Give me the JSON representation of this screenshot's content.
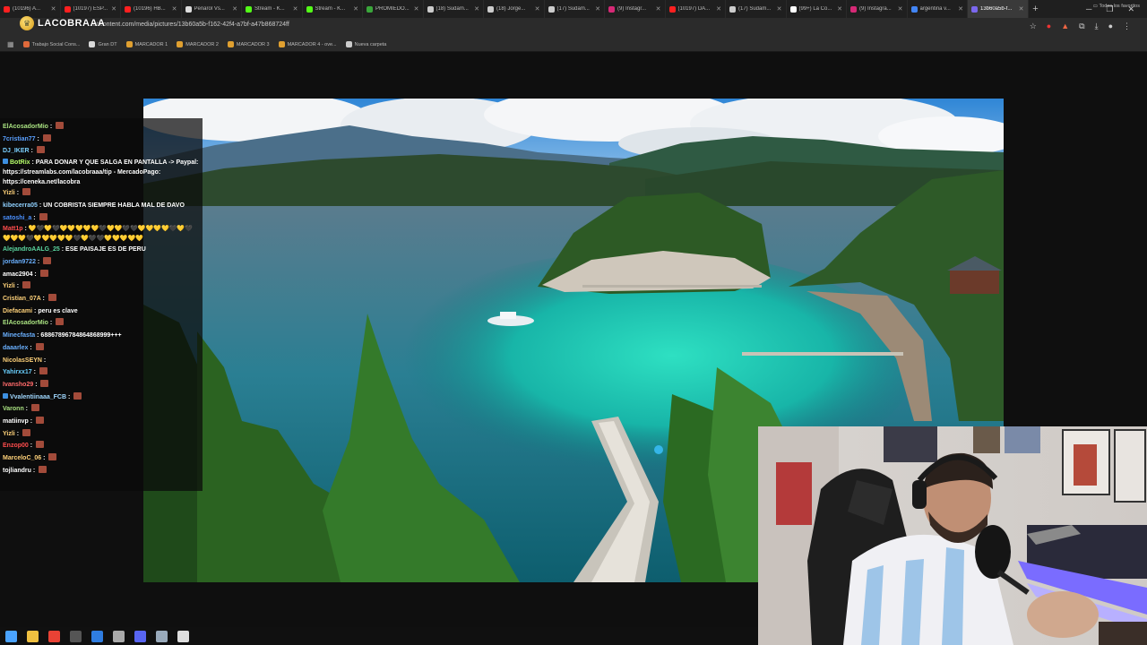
{
  "browser": {
    "tabs": [
      {
        "label": "(10196) A...",
        "color": "#ff2020",
        "active": false
      },
      {
        "label": "(10197) ESP...",
        "color": "#ff2020",
        "active": false
      },
      {
        "label": "(10196) HB...",
        "color": "#ff2020",
        "active": false
      },
      {
        "label": "Peñarol Vs...",
        "color": "#dddddd",
        "active": false
      },
      {
        "label": "Stream - K...",
        "color": "#53fc18",
        "active": false
      },
      {
        "label": "Stream - K...",
        "color": "#53fc18",
        "active": false
      },
      {
        "label": "PROMIEDO...",
        "color": "#3aa63a",
        "active": false
      },
      {
        "label": "(18) Sudam...",
        "color": "#cccccc",
        "active": false
      },
      {
        "label": "(18) Jorge...",
        "color": "#cccccc",
        "active": false
      },
      {
        "label": "(17) Sudam...",
        "color": "#cccccc",
        "active": false
      },
      {
        "label": "(9) Instagr...",
        "color": "#d62976",
        "active": false
      },
      {
        "label": "(10197) DA...",
        "color": "#ff2020",
        "active": false
      },
      {
        "label": "(17) Sudam...",
        "color": "#cccccc",
        "active": false
      },
      {
        "label": "(99+) La Co...",
        "color": "#ffffff",
        "active": false
      },
      {
        "label": "(9) Instagra...",
        "color": "#d62976",
        "active": false
      },
      {
        "label": "argentina v...",
        "color": "#4285f4",
        "active": false
      },
      {
        "label": "13b60a5b-f...",
        "color": "#7b68ee",
        "active": true
      }
    ],
    "new_tab": "+",
    "url": "...aticontent.com/media/pictures/13b60a5b-f162-42f4-a7bf-a47b868724ff",
    "bookmarks": [
      {
        "label": "Trabajo Social Cons...",
        "color": "#e06a3b"
      },
      {
        "label": "Gran DT",
        "color": "#d9d9d9"
      },
      {
        "label": "MARCADOR 1",
        "color": "#e0a030"
      },
      {
        "label": "MARCADOR 2",
        "color": "#e0a030"
      },
      {
        "label": "MARCADOR 3",
        "color": "#e0a030"
      },
      {
        "label": "MARCADOR 4 - ove...",
        "color": "#e0a030"
      },
      {
        "label": "Nueva carpeta",
        "color": "#cccccc"
      }
    ],
    "all_bookmarks": "Todos los favoritos"
  },
  "stream": {
    "logo_text": "LACOBRAAA"
  },
  "chat": [
    {
      "user": "ElAcosadorMio",
      "color": "#a8e080",
      "text": "",
      "emote": true
    },
    {
      "user": "7cristian77",
      "color": "#5aa0ff",
      "text": "",
      "emote": true
    },
    {
      "user": "DJ_IKER",
      "color": "#7ad0ff",
      "text": "",
      "emote": true
    },
    {
      "user": "BotRix",
      "color": "#b6ff6a",
      "text": "PARA DONAR Y QUE SALGA EN PANTALLA -> Paypal: https://streamlabs.com/lacobraaa/tip - MercadoPago: https://ceneka.net/lacobra",
      "emote": false,
      "badge": true,
      "multi": true
    },
    {
      "user": "Yizli",
      "color": "#ffd27a",
      "text": "",
      "emote": true
    },
    {
      "user": "kibecerra05",
      "color": "#8fd0ff",
      "text": "UN COBRISTA SIEMPRE HABLA MAL DE DAVO",
      "emote": false
    },
    {
      "user": "satoshi_a",
      "color": "#4a90ff",
      "text": "",
      "emote": true
    },
    {
      "user": "Matt1p",
      "color": "#ff4d4d",
      "text": "💛🖤💛🖤💛💛💛💛💛🖤💛💛🖤🖤💛💛💛💛🖤💛🖤💛💛💛🖤💛💛💛💛💛🖤💛🖤🖤💛💛💛💛💛",
      "emote": false,
      "multi": true
    },
    {
      "user": "AlejandroAALG_25",
      "color": "#5bd6a0",
      "text": "ESE PAISAJE ES DE PERU",
      "emote": false
    },
    {
      "user": "jordan9722",
      "color": "#6ab0ff",
      "text": "",
      "emote": true
    },
    {
      "user": "amac2904",
      "color": "#ffffff",
      "text": "",
      "emote": true
    },
    {
      "user": "Yizli",
      "color": "#ffd27a",
      "text": "",
      "emote": true
    },
    {
      "user": "Cristian_07A",
      "color": "#ffd27a",
      "text": "",
      "emote": true
    },
    {
      "user": "Diefacami",
      "color": "#ffd27a",
      "text": "peru es clave",
      "emote": false
    },
    {
      "user": "ElAcosadorMio",
      "color": "#a8e080",
      "text": "",
      "emote": true
    },
    {
      "user": "Minecfasta",
      "color": "#6ab0ff",
      "text": "68867896784864868999+++",
      "emote": false
    },
    {
      "user": "daaarlex",
      "color": "#6ab0ff",
      "text": "",
      "emote": true
    },
    {
      "user": "NicolasSEYN",
      "color": "#ffd27a",
      "text": "",
      "emote": false
    },
    {
      "user": "Yahirxx17",
      "color": "#6ad0ff",
      "text": "",
      "emote": true
    },
    {
      "user": "Ivansho29",
      "color": "#ff6a6a",
      "text": "",
      "emote": true
    },
    {
      "user": "Vvalentiinaaa_FCB",
      "color": "#a0d8ff",
      "text": "",
      "emote": true,
      "badge": true
    },
    {
      "user": "Varonn",
      "color": "#a8e080",
      "text": "",
      "emote": true
    },
    {
      "user": "matiinvp",
      "color": "#ffffff",
      "text": "",
      "emote": true
    },
    {
      "user": "Yizli",
      "color": "#ffd27a",
      "text": "",
      "emote": true
    },
    {
      "user": "Enzop00",
      "color": "#ff4d4d",
      "text": "",
      "emote": true
    },
    {
      "user": "MarceloC_06",
      "color": "#ffd27a",
      "text": "",
      "emote": true
    },
    {
      "user": "tojliandru",
      "color": "#ffffff",
      "text": "",
      "emote": true
    }
  ],
  "taskbar": [
    {
      "name": "windows-start-icon",
      "color": "#4aa3ff"
    },
    {
      "name": "file-explorer-icon",
      "color": "#f0c040"
    },
    {
      "name": "chrome-icon",
      "color": "#e94235"
    },
    {
      "name": "obs-icon",
      "color": "#555555"
    },
    {
      "name": "app-blue-icon",
      "color": "#2f7de1"
    },
    {
      "name": "app-chrome2-icon",
      "color": "#aaaaaa"
    },
    {
      "name": "discord-icon",
      "color": "#5865f2"
    },
    {
      "name": "app-files-icon",
      "color": "#9ab"
    },
    {
      "name": "app-square-icon",
      "color": "#ddd"
    }
  ]
}
